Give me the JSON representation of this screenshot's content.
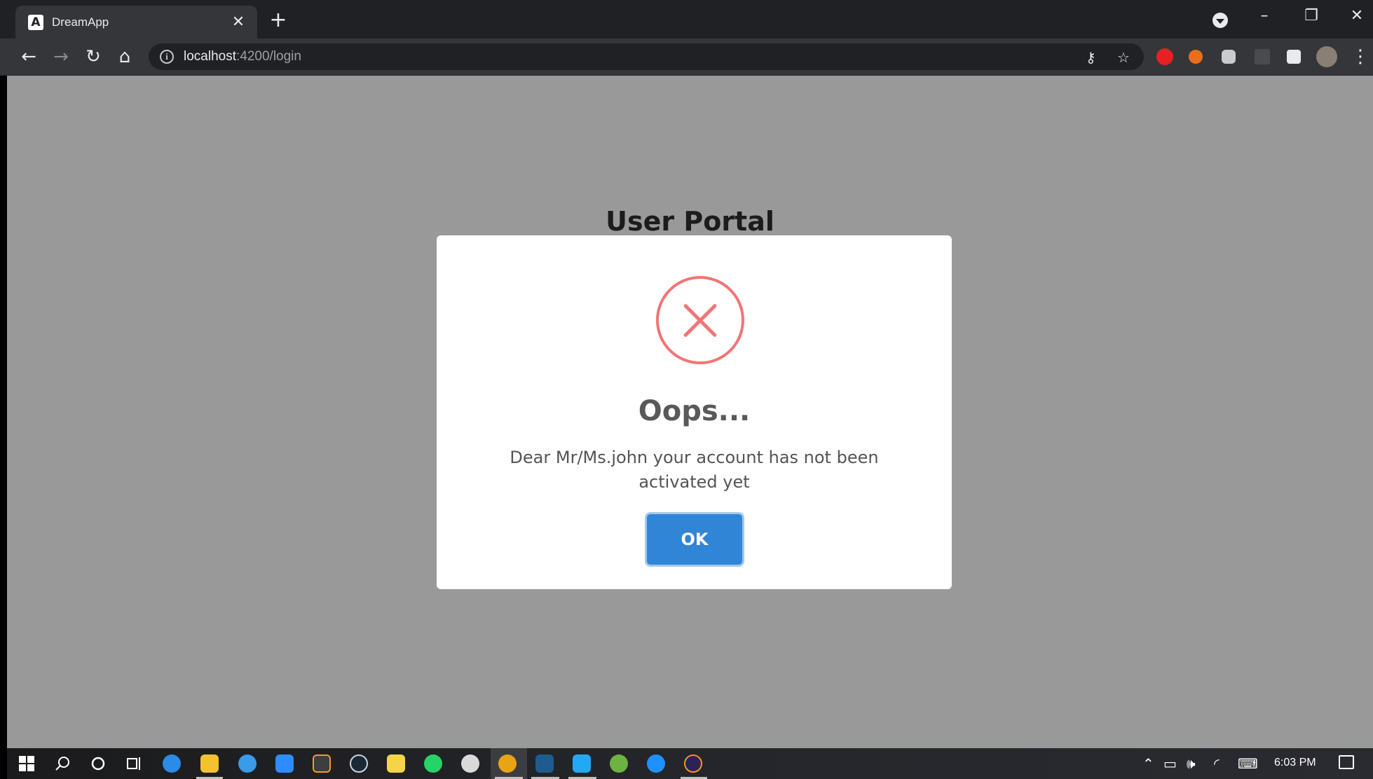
{
  "browser": {
    "tab_title": "DreamApp",
    "tab_favicon": "A",
    "tab_close": "✕",
    "new_tab": "+",
    "url_host": "localhost",
    "url_rest": ":4200/login",
    "window_controls": {
      "minimize": "–",
      "restore": "❐",
      "close": "✕"
    }
  },
  "page": {
    "title": "User Portal"
  },
  "modal": {
    "icon": "error-x-icon",
    "title": "Oops...",
    "text": "Dear Mr/Ms.john your account has not been activated yet",
    "ok_label": "OK"
  },
  "taskbar": {
    "time": "6:03 PM"
  },
  "colors": {
    "page_background": "#999999",
    "error_red": "#f27474",
    "button_blue": "#3085d6"
  }
}
